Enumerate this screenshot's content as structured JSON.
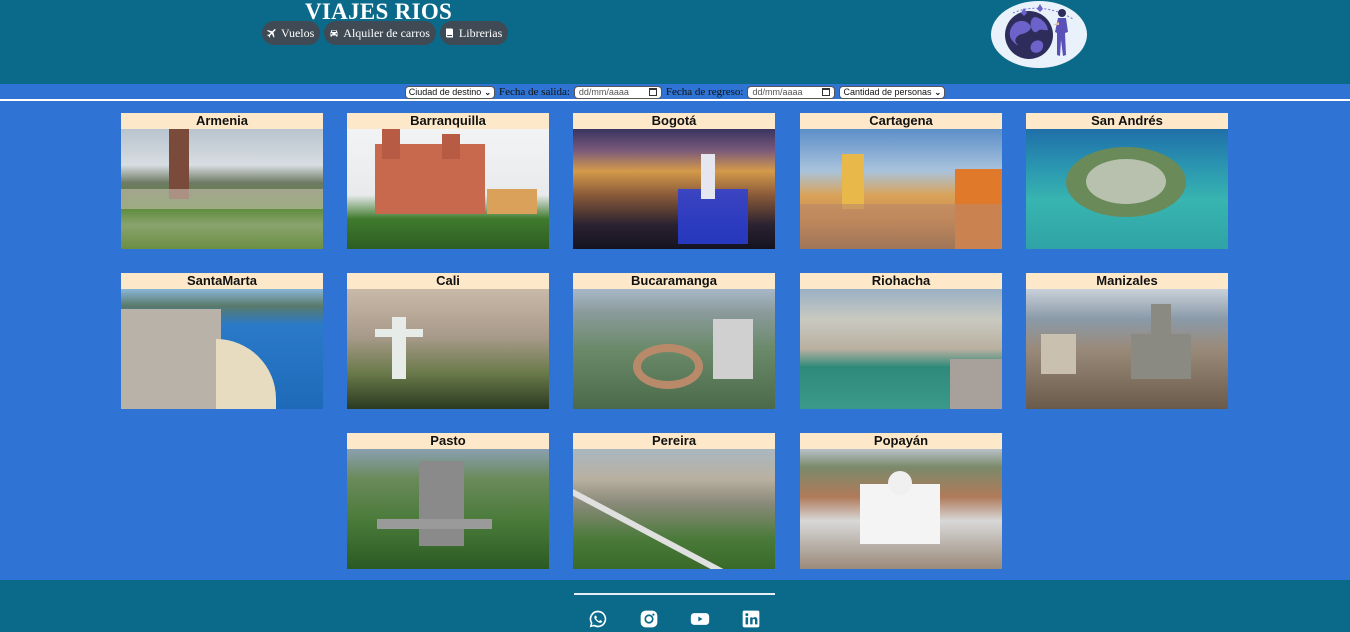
{
  "header": {
    "title": "VIAJES RIOS",
    "nav": [
      {
        "label": "Vuelos",
        "icon": "plane-icon"
      },
      {
        "label": "Alquiler de carros",
        "icon": "car-icon"
      },
      {
        "label": "Librerias",
        "icon": "book-icon"
      }
    ],
    "logo": "travel-globe-logo"
  },
  "search": {
    "destination": "Ciudad de destino",
    "departure_label": "Fecha de salida:",
    "departure_value": "dd/mm/aaaa",
    "return_label": "Fecha de regreso:",
    "return_value": "dd/mm/aaaa",
    "people": "Cantidad de personas"
  },
  "cities": [
    {
      "name": "Armenia"
    },
    {
      "name": "Barranquilla"
    },
    {
      "name": "Bogotá"
    },
    {
      "name": "Cartagena"
    },
    {
      "name": "San Andrés"
    },
    {
      "name": "SantaMarta"
    },
    {
      "name": "Cali"
    },
    {
      "name": "Bucaramanga"
    },
    {
      "name": "Riohacha"
    },
    {
      "name": "Manizales"
    },
    {
      "name": "Pasto"
    },
    {
      "name": "Pereira"
    },
    {
      "name": "Popayán"
    }
  ],
  "footer": {
    "social": [
      "whatsapp-icon",
      "instagram-icon",
      "youtube-icon",
      "linkedin-icon"
    ]
  },
  "colors": {
    "header_bg": "#0b6a8a",
    "page_bg": "#2f74d4",
    "card_title_bg": "#fde8c9",
    "nav_button_bg": "#3f4a54"
  }
}
